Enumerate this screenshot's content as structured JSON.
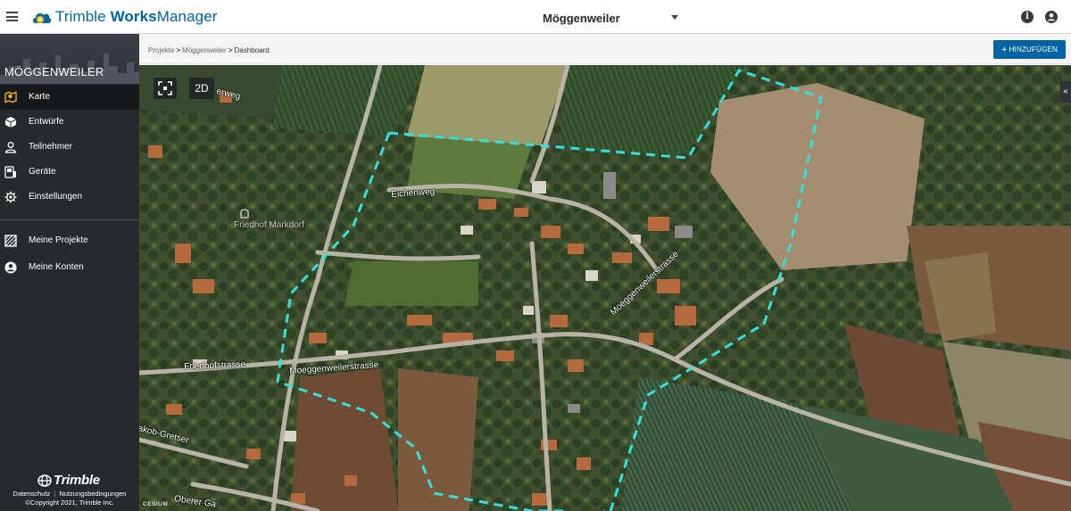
{
  "app": {
    "name_part1": "Trimble ",
    "name_part2": "Works",
    "name_part3": "Manager",
    "accent": "#0063a3"
  },
  "header": {
    "project_name": "Möggenweiler",
    "menu_icon": "hamburger-menu-icon",
    "info_icon": "info-icon",
    "account_icon": "account-icon"
  },
  "sidebar": {
    "project_title": "MÖGGENWEILER",
    "items": [
      {
        "label": "Karte",
        "icon": "map-pin-icon",
        "active": true
      },
      {
        "label": "Entwürfe",
        "icon": "cube-icon",
        "active": false
      },
      {
        "label": "Teilnehmer",
        "icon": "person-icon",
        "active": false
      },
      {
        "label": "Geräte",
        "icon": "device-icon",
        "active": false
      },
      {
        "label": "Einstellungen",
        "icon": "gear-icon",
        "active": false
      }
    ],
    "secondary_items": [
      {
        "label": "Meine Projekte",
        "icon": "projects-icon"
      },
      {
        "label": "Meine Konten",
        "icon": "account-circle-icon"
      }
    ],
    "footer": {
      "brand": "Trimble",
      "privacy": "Datenschutz",
      "separator": "|",
      "terms": "Nutzungsbedingungen",
      "copyright": "©Copyright 2021, Trimble Inc."
    }
  },
  "breadcrumb": {
    "items": [
      "Projekte",
      "Möggenweiler",
      "Dashboard"
    ]
  },
  "toolbar": {
    "add_label": "HINZUFÜGEN"
  },
  "map": {
    "view_mode": "2D",
    "fullscreen_icon": "fullscreen-icon",
    "collapse_label": "«",
    "attribution": "CESIUM",
    "poi": "Friedhof Markdorf",
    "streets": [
      "Eichenweg",
      "Friedhofstrasse",
      "Moeggenweilerstrasse",
      "Moeggenweilerstrasse",
      "akob-Gretser",
      "Oberer Ga",
      "erweg"
    ],
    "boundary_color": "#35e0dc"
  }
}
